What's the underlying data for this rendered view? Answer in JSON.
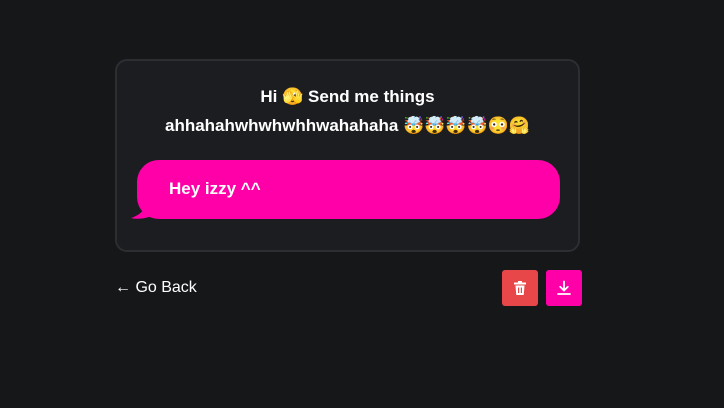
{
  "card": {
    "prompt_line1": "Hi 🫣 Send me things",
    "prompt_line2": "ahhahahwhwhwhhwahahaha 🤯🤯🤯🤯😳🤗",
    "reply_text": "Hey izzy ^^"
  },
  "nav": {
    "back_label": "← Go Back"
  },
  "actions": {
    "delete_icon": "trash-icon",
    "download_icon": "download-icon"
  },
  "colors": {
    "background": "#161719",
    "card_background": "#1c1d20",
    "card_border": "#2d2e32",
    "accent_pink": "#ff00a8",
    "delete_red": "#e8474a",
    "text": "#ffffff"
  }
}
